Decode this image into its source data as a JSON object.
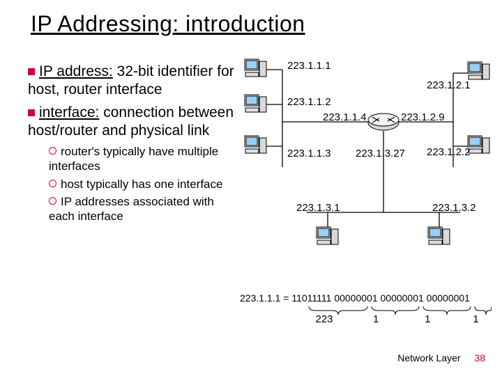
{
  "title": "IP Addressing: introduction",
  "bullets": {
    "b1_term": "IP address:",
    "b1_rest": " 32-bit identifier for host, router interface",
    "b2_term": "interface:",
    "b2_rest": " connection between host/router and physical link"
  },
  "subs": {
    "s1": "router's typically have multiple interfaces",
    "s2": "host typically has one interface",
    "s3": "IP addresses associated with each interface"
  },
  "ips": {
    "a": "223.1.1.1",
    "b": "223.1.1.2",
    "c": "223.1.1.3",
    "d": "223.1.1.4",
    "e": "223.1.2.1",
    "f": "223.1.2.2",
    "g": "223.1.2.9",
    "h": "223.1.3.27",
    "i": "223.1.3.1",
    "j": "223.1.3.2"
  },
  "binary": "223.1.1.1 = 11011111 00000001 00000001 00000001",
  "octets": {
    "o1": "223",
    "o2": "1",
    "o3": "1",
    "o4": "1"
  },
  "footer": {
    "section": "Network Layer",
    "page": "38"
  }
}
